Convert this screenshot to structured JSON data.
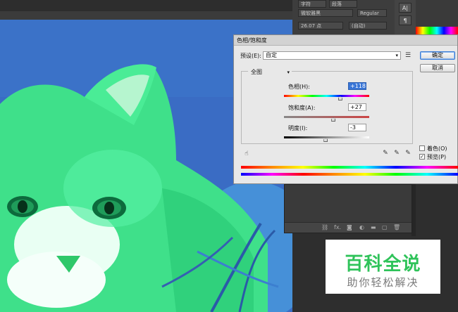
{
  "photoshop": {
    "font_family_value": "微软雅黑",
    "font_style_value": "Regular",
    "font_size_value": "26.07 点",
    "leading_value": "(自动)",
    "top_labels": [
      "字符",
      "段落"
    ],
    "layers_footer_icons": [
      "link-icon",
      "fx-icon",
      "mask-icon",
      "adjustment-icon",
      "folder-icon",
      "new-layer-icon",
      "trash-icon"
    ],
    "fx_label": "fx."
  },
  "dialog": {
    "title": "色相/饱和度",
    "preset_label": "预设(E):",
    "preset_value": "自定",
    "ok_label": "确定",
    "cancel_label": "取消",
    "channel_value": "全图",
    "hue_label": "色相(H):",
    "hue_value": "+118",
    "saturation_label": "饱和度(A):",
    "saturation_value": "+27",
    "lightness_label": "明度(I):",
    "lightness_value": "-3",
    "colorize_label": "着色(O)",
    "colorize_checked": false,
    "preview_label": "预览(P)",
    "preview_checked": true,
    "hue_level": 0.66,
    "saturation_level": 0.58,
    "lightness_level": 0.49
  },
  "watermark": {
    "line1": "百科全说",
    "line2": "助你轻松解决"
  },
  "colors": {
    "accent": "#3875d7",
    "watermark_green": "#2fc35a",
    "cat_green": "#3fe08a"
  }
}
